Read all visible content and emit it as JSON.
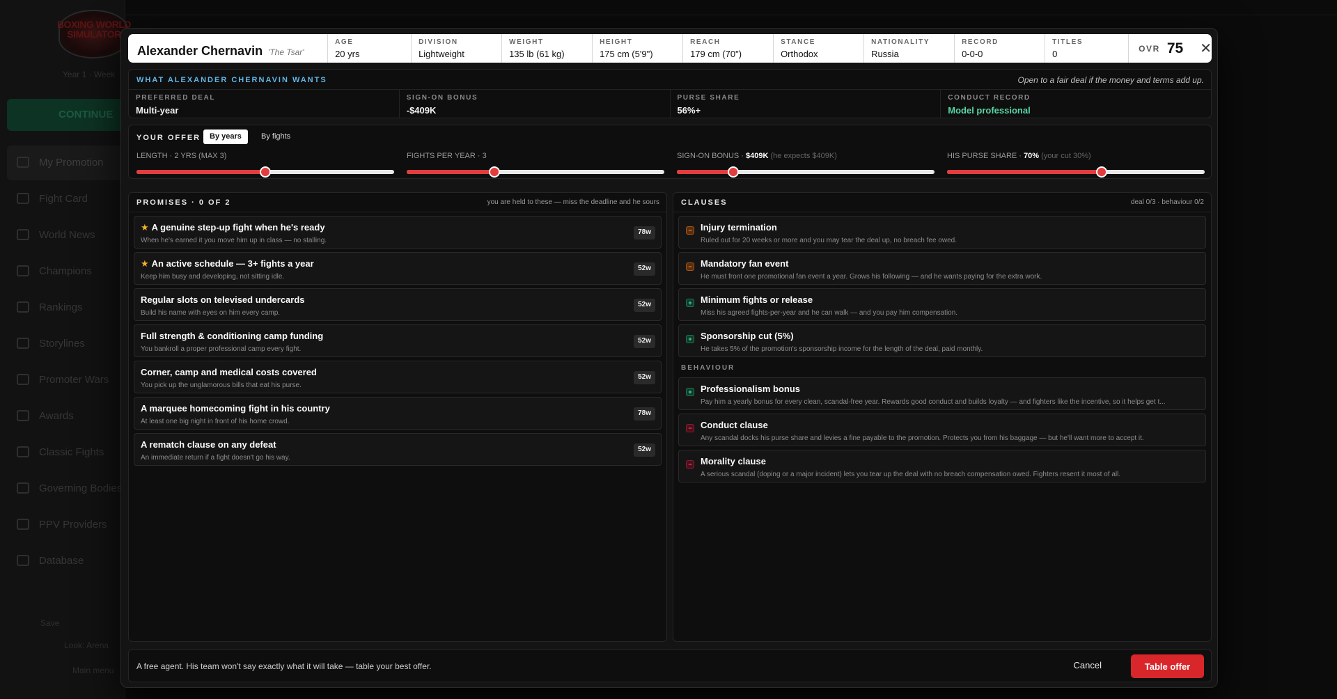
{
  "background": {
    "logo_text": "BOXING WORLD SIMULATOR",
    "year_line": "Year 1 · Week",
    "continue_label": "CONTINUE",
    "nav": [
      "My Promotion",
      "Fight Card",
      "World News",
      "Champions",
      "Rankings",
      "Storylines",
      "Promoter Wars",
      "Awards",
      "Classic Fights",
      "Governing Bodies",
      "PPV Providers",
      "Database"
    ],
    "save_label": "Save",
    "look_label": "Look: Arena",
    "main_menu_label": "Main menu"
  },
  "header": {
    "name": "Alexander Chernavin",
    "nickname": "'The Tsar'",
    "columns": [
      {
        "label": "AGE",
        "value": "20 yrs"
      },
      {
        "label": "DIVISION",
        "value": "Lightweight"
      },
      {
        "label": "WEIGHT",
        "value": "135 lb (61 kg)"
      },
      {
        "label": "HEIGHT",
        "value": "175 cm (5'9\")"
      },
      {
        "label": "REACH",
        "value": "179 cm (70\")"
      },
      {
        "label": "STANCE",
        "value": "Orthodox"
      },
      {
        "label": "NATIONALITY",
        "value": "Russia"
      },
      {
        "label": "RECORD",
        "value": "0-0-0"
      },
      {
        "label": "TITLES",
        "value": "0"
      }
    ],
    "ovr_label": "OVR",
    "ovr_value": "75",
    "close_icon": "close-icon"
  },
  "wants": {
    "title": "WHAT ALEXANDER CHERNAVIN WANTS",
    "note": "Open to a fair deal if the money and terms add up.",
    "cells": [
      {
        "label": "PREFERRED DEAL",
        "value": "Multi-year"
      },
      {
        "label": "SIGN-ON BONUS",
        "value": "-$409K"
      },
      {
        "label": "PURSE SHARE",
        "value": "56%+"
      },
      {
        "label": "CONDUCT RECORD",
        "value": "Model professional"
      }
    ]
  },
  "offer": {
    "title": "YOUR OFFER",
    "toggle_on": "By years",
    "toggle_off": "By fights",
    "sliders": [
      {
        "label": "LENGTH · 2 YRS (MAX 3)",
        "strong": "",
        "dim": "",
        "fraction": 0.5
      },
      {
        "label": "FIGHTS PER YEAR · 3",
        "strong": "",
        "dim": "",
        "fraction": 0.34
      },
      {
        "label": "SIGN-ON BONUS · ",
        "strong": "$409K",
        "dim": " (he expects $409K)",
        "fraction": 0.22
      },
      {
        "label": "HIS PURSE SHARE · ",
        "strong": "70%",
        "dim": " (your cut 30%)",
        "fraction": 0.6
      }
    ]
  },
  "promises": {
    "title": "PROMISES · 0 OF 2",
    "note": "you are held to these — miss the deadline and he sours",
    "items": [
      {
        "star": true,
        "title": "A genuine step-up fight when he's ready",
        "sub": "When he's earned it you move him up in class — no stalling.",
        "badge": "78w"
      },
      {
        "star": true,
        "title": "An active schedule — 3+ fights a year",
        "sub": "Keep him busy and developing, not sitting idle.",
        "badge": "52w"
      },
      {
        "star": false,
        "title": "Regular slots on televised undercards",
        "sub": "Build his name with eyes on him every camp.",
        "badge": "52w"
      },
      {
        "star": false,
        "title": "Full strength & conditioning camp funding",
        "sub": "You bankroll a proper professional camp every fight.",
        "badge": "52w"
      },
      {
        "star": false,
        "title": "Corner, camp and medical costs covered",
        "sub": "You pick up the unglamorous bills that eat his purse.",
        "badge": "52w"
      },
      {
        "star": false,
        "title": "A marquee homecoming fight in his country",
        "sub": "At least one big night in front of his home crowd.",
        "badge": "78w"
      },
      {
        "star": false,
        "title": "A rematch clause on any defeat",
        "sub": "An immediate return if a fight doesn't go his way.",
        "badge": "52w"
      }
    ]
  },
  "clauses": {
    "title": "CLAUSES",
    "note": "deal 0/3 · behaviour 0/2",
    "deal": [
      {
        "icon": "orange",
        "glyph": "−",
        "title": "Injury termination",
        "sub": "Ruled out for 20 weeks or more and you may tear the deal up, no breach fee owed."
      },
      {
        "icon": "orange",
        "glyph": "−",
        "title": "Mandatory fan event",
        "sub": "He must front one promotional fan event a year. Grows his following — and he wants paying for the extra work."
      },
      {
        "icon": "green",
        "glyph": "+",
        "title": "Minimum fights or release",
        "sub": "Miss his agreed fights-per-year and he can walk — and you pay him compensation."
      },
      {
        "icon": "green",
        "glyph": "+",
        "title": "Sponsorship cut (5%)",
        "sub": "He takes 5% of the promotion's sponsorship income for the length of the deal, paid monthly."
      }
    ],
    "behaviour_title": "BEHAVIOUR",
    "behaviour": [
      {
        "icon": "green",
        "glyph": "+",
        "title": "Professionalism bonus",
        "sub": "Pay him a yearly bonus for every clean, scandal-free year. Rewards good conduct and builds loyalty — and fighters like the incentive, so it helps get t..."
      },
      {
        "icon": "red",
        "glyph": "−",
        "title": "Conduct clause",
        "sub": "Any scandal docks his purse share and levies a fine payable to the promotion. Protects you from his baggage — but he'll want more to accept it."
      },
      {
        "icon": "red",
        "glyph": "−",
        "title": "Morality clause",
        "sub": "A serious scandal (doping or a major incident) lets you tear up the deal with no breach compensation owed. Fighters resent it most of all."
      }
    ]
  },
  "footer": {
    "text": "A free agent. His team won't say exactly what it will take — table your best offer.",
    "cancel": "Cancel",
    "submit": "Table offer"
  },
  "colors": {
    "accent_red": "#d9262b",
    "accent_blue": "#62b6e6",
    "accent_green": "#58d7a5",
    "star": "#f5b323"
  }
}
